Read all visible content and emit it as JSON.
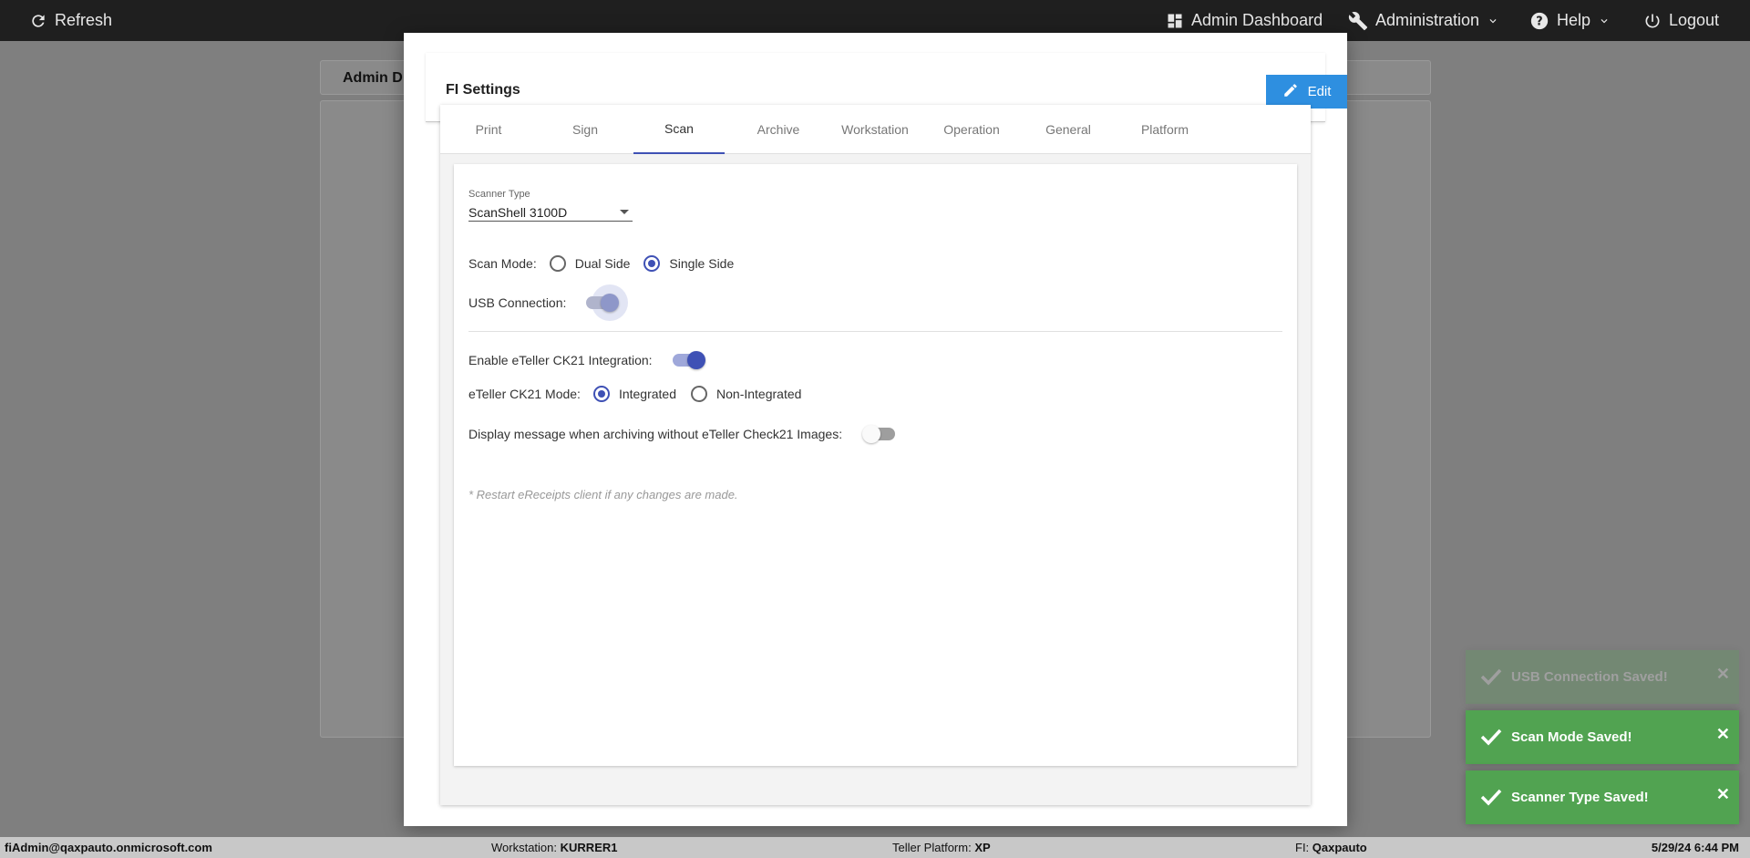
{
  "topbar": {
    "refresh": "Refresh",
    "admin_dashboard": "Admin Dashboard",
    "administration": "Administration",
    "help": "Help",
    "logout": "Logout",
    "icons": [
      "refresh-icon",
      "dashboard-icon",
      "wrench-icon",
      "help-icon",
      "power-icon",
      "chevron-down-icon"
    ]
  },
  "background": {
    "tab_label": "Admin D"
  },
  "modal": {
    "title": "FI Settings",
    "edit_label": "Edit",
    "tabs": [
      "Print",
      "Sign",
      "Scan",
      "Archive",
      "Workstation",
      "Operation",
      "General",
      "Platform"
    ],
    "active_tab": "Scan",
    "scan": {
      "scanner_type_label": "Scanner Type",
      "scanner_type_value": "ScanShell 3100D",
      "scan_mode_label": "Scan Mode:",
      "scan_mode_options": [
        "Dual Side",
        "Single Side"
      ],
      "scan_mode_selected": "Single Side",
      "usb_label": "USB Connection:",
      "usb_on": true,
      "ck21_enable_label": "Enable eTeller CK21 Integration:",
      "ck21_enable_on": true,
      "ck21_mode_label": "eTeller CK21 Mode:",
      "ck21_mode_options": [
        "Integrated",
        "Non-Integrated"
      ],
      "ck21_mode_selected": "Integrated",
      "display_msg_label": "Display message when archiving without eTeller Check21 Images:",
      "display_msg_on": false,
      "note": "* Restart eReceipts client if any changes are made."
    }
  },
  "toasts": [
    {
      "message": "USB Connection Saved!",
      "faded": true
    },
    {
      "message": "Scan Mode Saved!",
      "faded": false
    },
    {
      "message": "Scanner Type Saved!",
      "faded": false
    }
  ],
  "colors": {
    "accent": "#3f51b5",
    "edit_button": "#2e8fe0",
    "toast_success": "#51a351",
    "topbar": "#1f1f1f"
  },
  "statusbar": {
    "user": "fiAdmin@qaxpauto.onmicrosoft.com",
    "workstation_label": "Workstation:",
    "workstation_value": "KURRER1",
    "platform_label": "Teller Platform:",
    "platform_value": "XP",
    "fi_label": "FI:",
    "fi_value": "Qaxpauto",
    "datetime": "5/29/24 6:44 PM"
  }
}
